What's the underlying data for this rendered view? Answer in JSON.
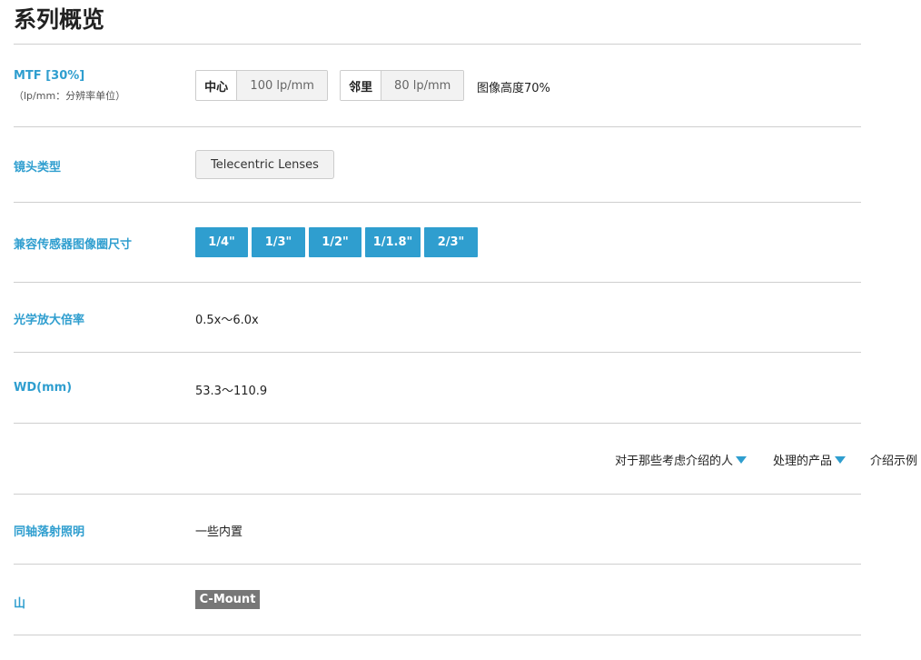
{
  "page_title": "系列概览",
  "mtf": {
    "label": "MTF [30%]",
    "sublabel": "（lp/mm：分辨率单位）",
    "center_key": "中心",
    "center_value": "100 lp/mm",
    "edge_key": "邻里",
    "edge_value": "80 lp/mm",
    "note": "图像高度70%"
  },
  "lens_type": {
    "label": "镜头类型",
    "value": "Telecentric Lenses"
  },
  "sensor_size": {
    "label": "兼容传感器图像圈尺寸",
    "options": [
      "1/4\"",
      "1/3\"",
      "1/2\"",
      "1/1.8\"",
      "2/3\""
    ]
  },
  "magnification": {
    "label": "光学放大倍率",
    "value": "0.5x〜6.0x"
  },
  "wd": {
    "label": "WD(mm)",
    "value": "53.3〜110.9"
  },
  "filters": {
    "audience": "对于那些考虑介绍的人",
    "products": "处理的产品",
    "examples": "介绍示例"
  },
  "coaxial": {
    "label": "同轴落射照明",
    "value": "一些内置"
  },
  "mount": {
    "label": "山",
    "value": "C-Mount"
  },
  "colors": {
    "accent": "#2f9ecf",
    "badge": "#777777",
    "divider": "#cfcfcf"
  }
}
